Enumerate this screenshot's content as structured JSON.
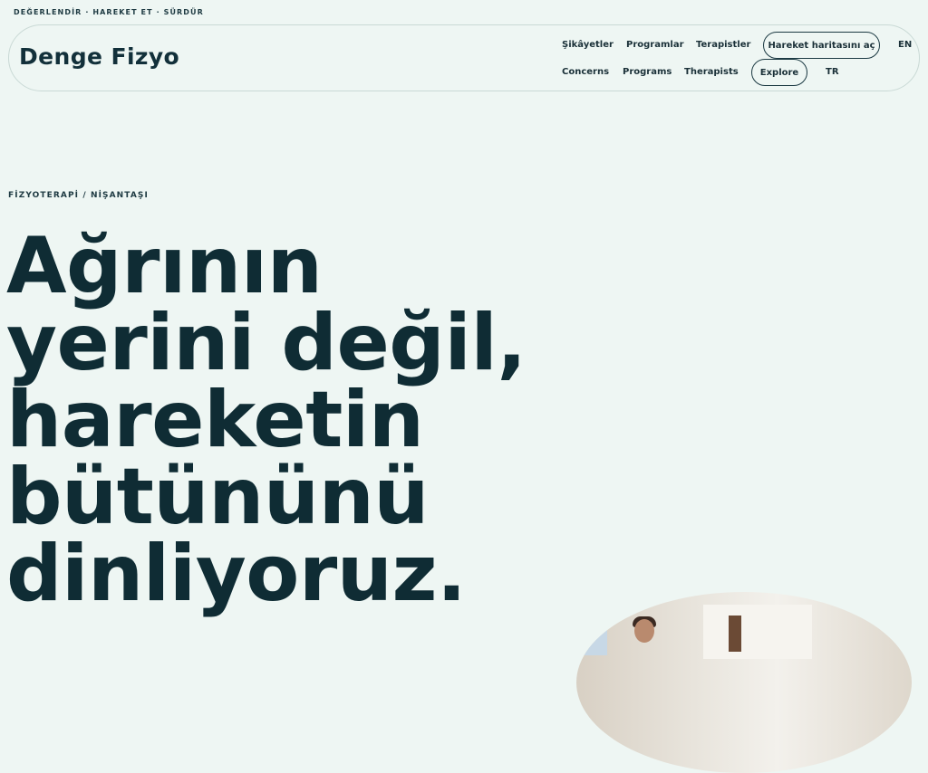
{
  "topline": "DEĞERLENDİR · HAREKET ET · SÜRDÜR",
  "brand": {
    "name": "Denge Fizyo"
  },
  "nav_tr": {
    "items": [
      "Şikâyetler",
      "Programlar",
      "Terapistler"
    ],
    "cta": "Hareket haritasını aç",
    "lang": "EN"
  },
  "nav_en": {
    "items": [
      "Concerns",
      "Programs",
      "Therapists"
    ],
    "cta": "Explore",
    "lang": "TR"
  },
  "hero": {
    "eyebrow": "FİZYOTERAPİ / NİŞANTAŞI",
    "headline_lines": [
      "Ağrının",
      "yerini değil,",
      "hareketin",
      "bütününü",
      "dinliyoruz."
    ]
  },
  "colors": {
    "background": "#eef6f3",
    "text": "#0f2c34",
    "border": "#c9d9d5"
  }
}
